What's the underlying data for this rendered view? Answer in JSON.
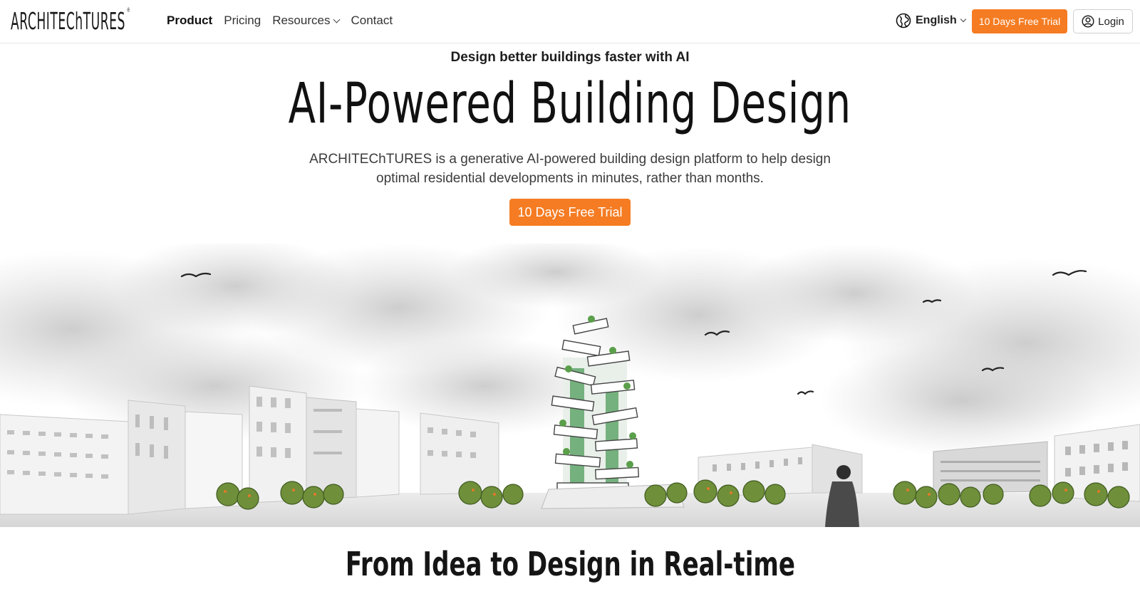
{
  "header": {
    "logo": "ARCHITEChTURES",
    "logo_mark": "®",
    "nav": [
      {
        "label": "Product",
        "active": true
      },
      {
        "label": "Pricing",
        "active": false
      },
      {
        "label": "Resources",
        "active": false,
        "dropdown": true
      },
      {
        "label": "Contact",
        "active": false
      }
    ],
    "language": "English",
    "trial_button": "10 Days Free Trial",
    "login_button": "Login"
  },
  "hero": {
    "eyebrow": "Design better buildings faster with AI",
    "title": "AI-Powered Building Design",
    "description": "ARCHITEChTURES is a generative AI-powered building design platform to help design optimal residential developments in minutes, rather than months.",
    "cta": "10 Days Free Trial"
  },
  "section": {
    "title": "From Idea to Design in Real-time"
  },
  "colors": {
    "accent": "#f57c22",
    "text": "#111111"
  },
  "icons": {
    "language": "globe-icon",
    "login": "user-circle-icon",
    "dropdown": "chevron-down-icon"
  }
}
